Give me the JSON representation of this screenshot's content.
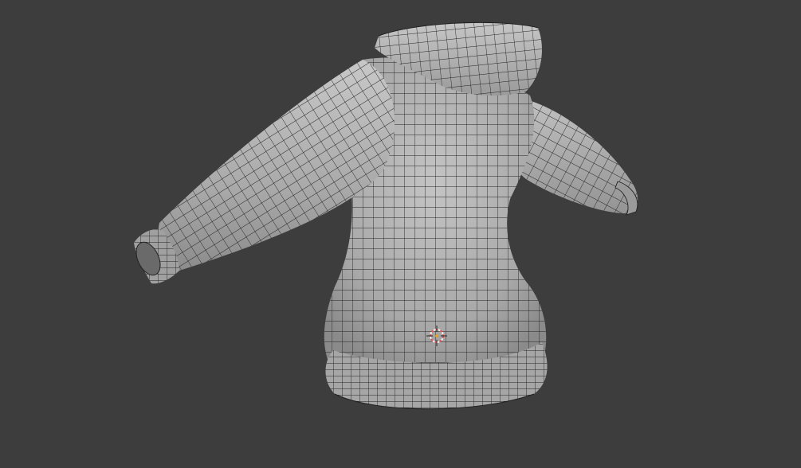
{
  "viewport": {
    "background": "#3d3d3d",
    "mesh_shade": "#b4b4b4",
    "wire_color": "#1e1e1e"
  },
  "scene": {
    "object": "hoodie-mesh",
    "shading_mode": "solid",
    "wireframe_overlay": true,
    "origin_marker": "3d-cursor-icon"
  }
}
